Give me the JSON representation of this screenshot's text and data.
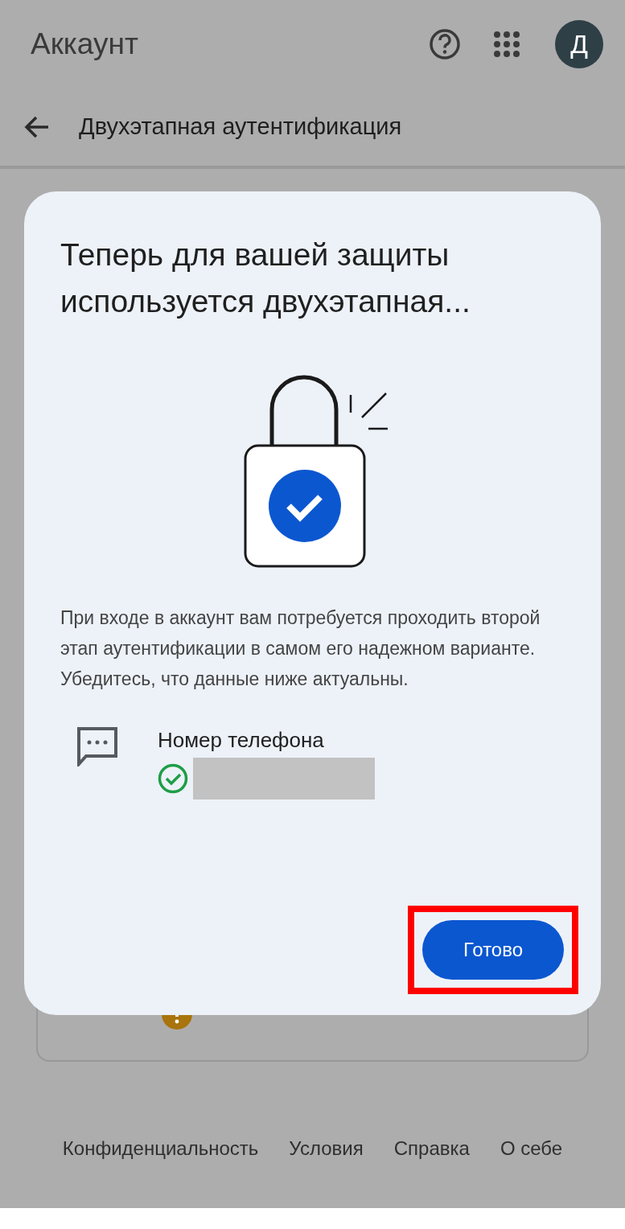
{
  "header": {
    "title": "Аккаунт",
    "avatar_letter": "Д",
    "page_title": "Двухэтапная аутентификация"
  },
  "dialog": {
    "title": "Теперь для вашей защиты используется двухэтапная...",
    "message": "При входе в аккаунт вам потребуется проходить второй этап аутентификации в самом его надежном варианте. Убедитесь, что данные ниже актуальны.",
    "method": {
      "label": "Номер телефона",
      "verified": true,
      "redacted": true
    },
    "button": {
      "label": "Готово",
      "highlighted": true
    }
  },
  "footer": {
    "links": [
      "Конфиденциальность",
      "Условия",
      "Справка",
      "О себе"
    ]
  }
}
